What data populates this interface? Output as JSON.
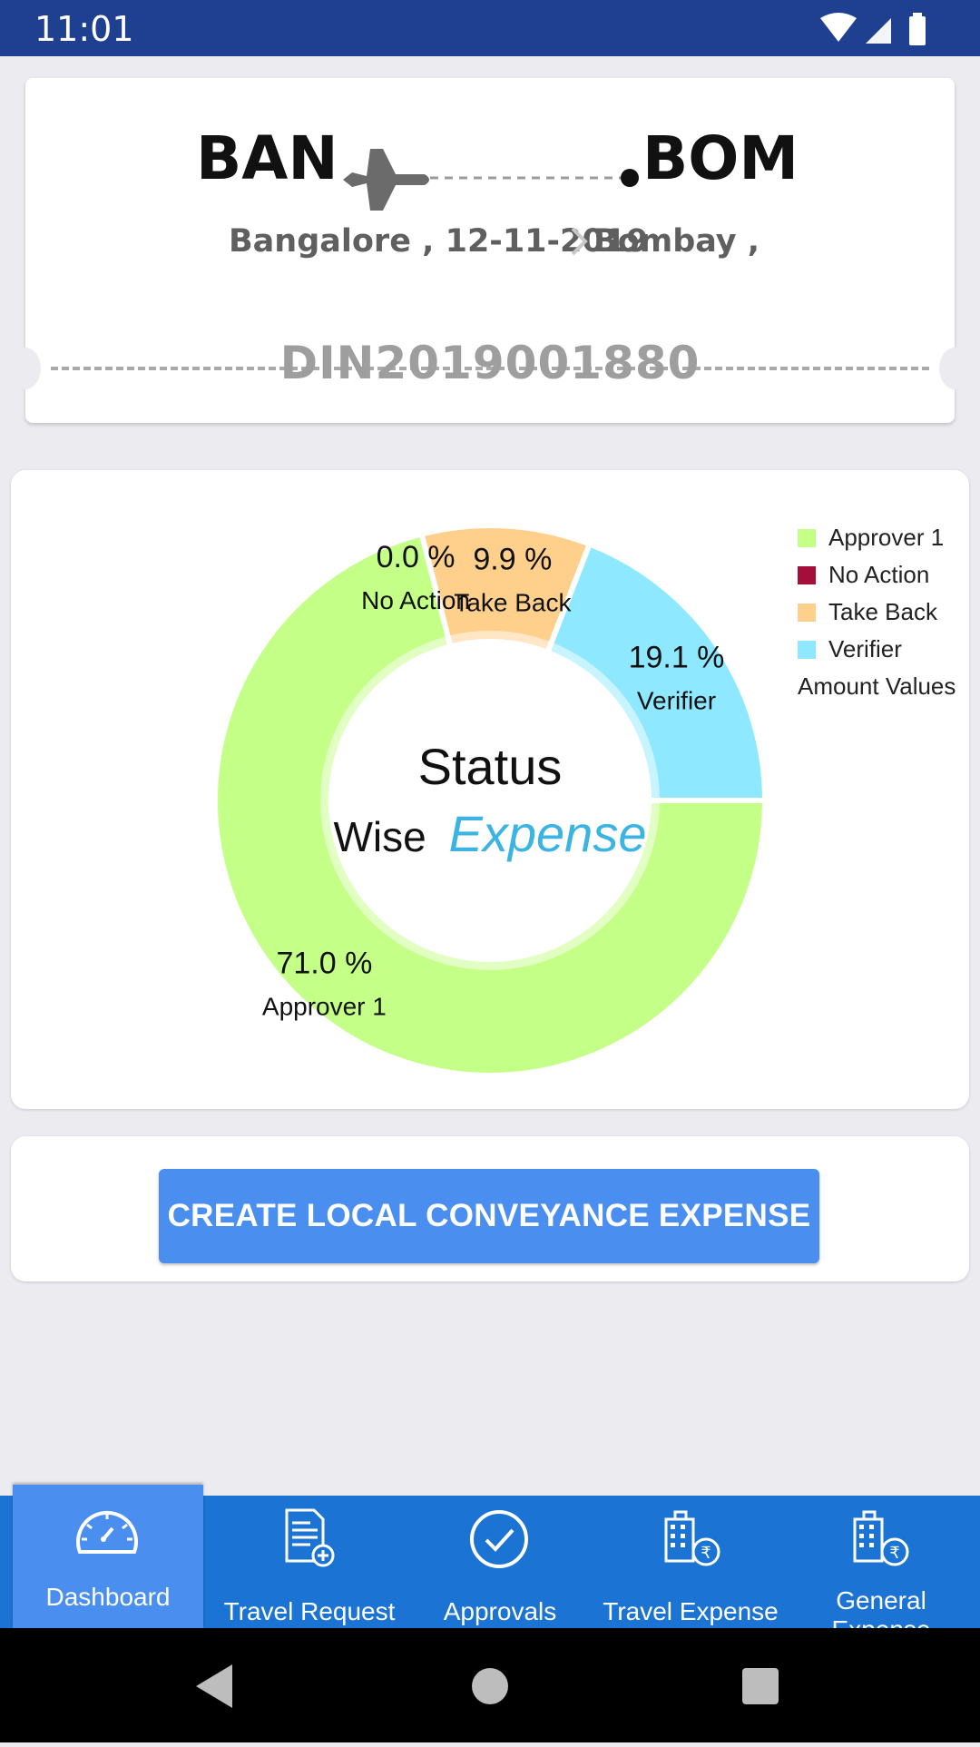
{
  "status_bar": {
    "time": "11:01"
  },
  "ticket": {
    "from_code": "BAN",
    "to_code": "BOM",
    "from_detail": "Bangalore , 12-11-2019",
    "to_detail": "Bombay ,",
    "document_number": "DIN2019001880"
  },
  "chart": {
    "center_line1": "Status",
    "center_line2_prefix": "Wise",
    "center_line2_accent": "Expense",
    "legend_description": "Amount Values"
  },
  "chart_data": {
    "type": "pie",
    "categories": [
      "Approver 1",
      "No Action",
      "Take Back",
      "Verifier"
    ],
    "values": [
      71.0,
      0.0,
      9.9,
      19.1
    ],
    "value_labels": [
      "71.0 %",
      "0.0 %",
      "9.9 %",
      "19.1 %"
    ],
    "colors": [
      "#c4ff87",
      "#a60e3a",
      "#ffcf8c",
      "#8ee8ff"
    ],
    "legend_position": "top-right",
    "donut": true
  },
  "actions": {
    "create_button": "CREATE LOCAL CONVEYANCE EXPENSE"
  },
  "nav": {
    "items": [
      {
        "label": "Dashboard",
        "icon": "speedometer-icon"
      },
      {
        "label": "Travel Request",
        "icon": "document-add-icon"
      },
      {
        "label": "Approvals",
        "icon": "check-circle-icon"
      },
      {
        "label": "Travel Expense",
        "icon": "building-rupee-icon"
      },
      {
        "label": "General Expense",
        "icon": "building-rupee-icon"
      }
    ],
    "active_index": 0
  }
}
